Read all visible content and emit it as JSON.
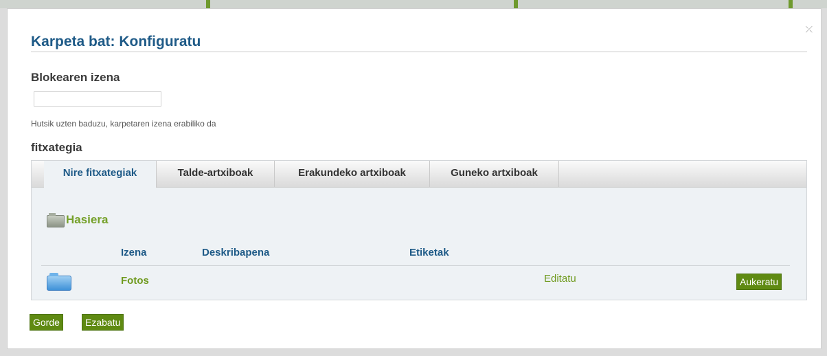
{
  "dialog": {
    "title": "Karpeta bat: Konfiguratu",
    "close_glyph": "⤫"
  },
  "block_name": {
    "label": "Blokearen izena",
    "value": "",
    "hint": "Hutsik uzten baduzu, karpetaren izena erabiliko da"
  },
  "file_section": {
    "label": "fitxategia",
    "tabs": [
      {
        "label": "Nire fitxategiak",
        "active": true
      },
      {
        "label": "Talde-artxiboak",
        "active": false
      },
      {
        "label": "Erakundeko artxiboak",
        "active": false
      },
      {
        "label": "Guneko artxiboak",
        "active": false
      }
    ],
    "breadcrumb": "Hasiera",
    "columns": [
      "Izena",
      "Deskribapena",
      "Etiketak"
    ],
    "rows": [
      {
        "name": "Fotos",
        "description": "",
        "tags": "",
        "edit_label": "Editatu",
        "select_label": "Aukeratu"
      }
    ]
  },
  "actions": {
    "save_label": "Gorde",
    "delete_label": "Ezabatu"
  },
  "colors": {
    "title_blue": "#1e5a87",
    "link_green": "#6f9a1e",
    "button_green": "#5f8a12"
  },
  "icons": [
    "close-icon",
    "home-folder-icon",
    "folder-icon"
  ]
}
